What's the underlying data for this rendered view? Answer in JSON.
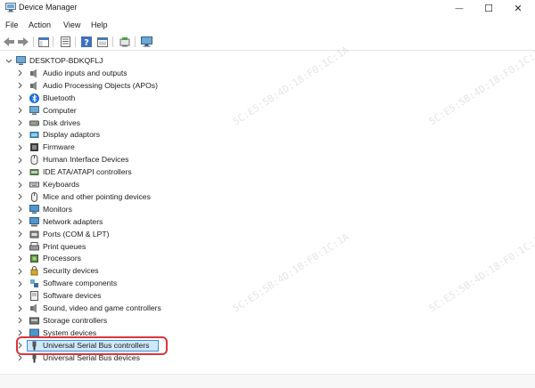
{
  "window": {
    "title": "Device Manager",
    "minimize_glyph": "—",
    "maximize_glyph": "☐",
    "close_glyph": "✕"
  },
  "menu": [
    "File",
    "Action",
    "View",
    "Help"
  ],
  "toolbar": {
    "icons": [
      "back-arrow-icon",
      "forward-arrow-icon",
      "show-hide-tree-icon",
      "properties-icon",
      "help-icon",
      "view-resources-icon",
      "update-driver-icon",
      "scan-hardware-icon"
    ]
  },
  "tree": {
    "root": "DESKTOP-BDKQFLJ",
    "items": [
      {
        "label": "Audio inputs and outputs",
        "icon": "speaker-icon"
      },
      {
        "label": "Audio Processing Objects (APOs)",
        "icon": "audio-processing-icon"
      },
      {
        "label": "Bluetooth",
        "icon": "bluetooth-icon"
      },
      {
        "label": "Computer",
        "icon": "computer-icon"
      },
      {
        "label": "Disk drives",
        "icon": "disk-drive-icon"
      },
      {
        "label": "Display adaptors",
        "icon": "display-adapter-icon"
      },
      {
        "label": "Firmware",
        "icon": "firmware-icon"
      },
      {
        "label": "Human Interface Devices",
        "icon": "hid-icon"
      },
      {
        "label": "IDE ATA/ATAPI controllers",
        "icon": "ide-controller-icon"
      },
      {
        "label": "Keyboards",
        "icon": "keyboard-icon"
      },
      {
        "label": "Mice and other pointing devices",
        "icon": "mouse-icon"
      },
      {
        "label": "Monitors",
        "icon": "monitor-icon"
      },
      {
        "label": "Network adapters",
        "icon": "network-adapter-icon"
      },
      {
        "label": "Ports (COM & LPT)",
        "icon": "ports-icon"
      },
      {
        "label": "Print queues",
        "icon": "printer-icon"
      },
      {
        "label": "Processors",
        "icon": "processor-icon"
      },
      {
        "label": "Security devices",
        "icon": "security-device-icon"
      },
      {
        "label": "Software components",
        "icon": "software-component-icon"
      },
      {
        "label": "Software devices",
        "icon": "software-device-icon"
      },
      {
        "label": "Sound, video and game controllers",
        "icon": "sound-controller-icon"
      },
      {
        "label": "Storage controllers",
        "icon": "storage-controller-icon"
      },
      {
        "label": "System devices",
        "icon": "system-device-icon"
      },
      {
        "label": "Universal Serial Bus controllers",
        "icon": "usb-icon",
        "selected": true
      },
      {
        "label": "Universal Serial Bus devices",
        "icon": "usb-device-icon"
      }
    ]
  },
  "colors": {
    "selection_fill": "#cde8fb",
    "selection_border": "#3d8ee0",
    "annotation_outline": "#d9363b"
  },
  "watermark": "5C:E5:5B:4D:18:F0:1C:1A"
}
